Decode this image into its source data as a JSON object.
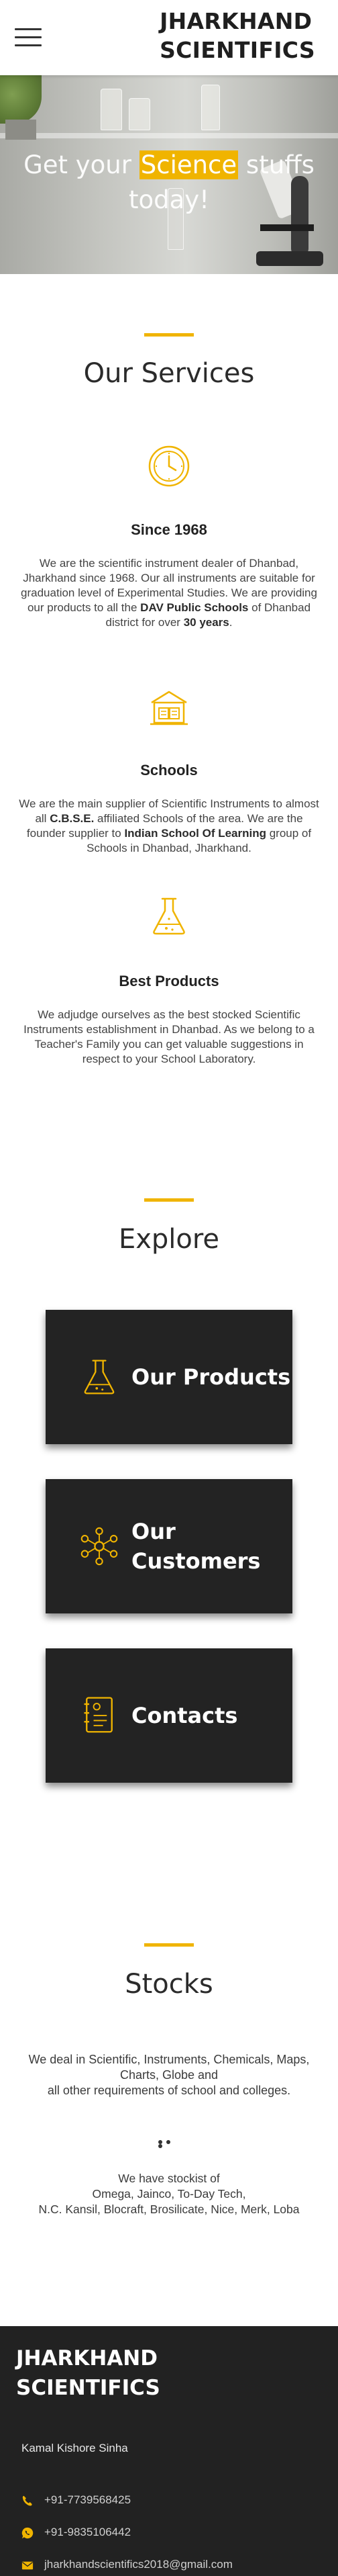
{
  "header": {
    "brand_line1": "JHARKHAND",
    "brand_line2": "SCIENTIFICS",
    "menu_icon": "hamburger-menu-icon"
  },
  "hero": {
    "title_before": "Get your ",
    "title_highlight": "Science",
    "title_after": " stuffs",
    "title_line2": "today!",
    "highlight_color": "#f0b400"
  },
  "services": {
    "heading": "Our Services",
    "items": [
      {
        "icon": "clock-icon",
        "title": "Since 1968",
        "text_1": "We are the scientific instrument dealer of Dhanbad, Jharkhand since 1968. Our all instruments are suitable for graduation level of Experimental Studies. We are providing our products to all the ",
        "bold_1": "DAV Public Schools",
        "text_2": " of Dhanbad district for over ",
        "bold_2": "30 years",
        "text_3": "."
      },
      {
        "icon": "school-book-icon",
        "title": "Schools",
        "text_1": "We are the main supplier of Scientific Instruments to almost all ",
        "bold_1": "C.B.S.E.",
        "text_2": " affiliated Schools of the area. We are the founder supplier to ",
        "bold_2": "Indian School Of Learning",
        "text_3": " group of Schools in Dhanbad, Jharkhand."
      },
      {
        "icon": "flask-icon",
        "title": "Best Products",
        "text_1": "We adjudge ourselves as the best stocked Scientific Instruments establishment in Dhanbad. As we belong to a Teacher's Family you can get valuable suggestions in respect to your School Laboratory."
      }
    ]
  },
  "explore": {
    "heading": "Explore",
    "cards": [
      {
        "icon": "flask-icon",
        "label_1": "Our Products",
        "label_2": ""
      },
      {
        "icon": "network-people-icon",
        "label_1": "Our",
        "label_2": "Customers"
      },
      {
        "icon": "contact-list-icon",
        "label_1": "Contacts",
        "label_2": ""
      }
    ]
  },
  "stocks": {
    "heading": "Stocks",
    "line_1": "We deal in Scientific, Instruments, Chemicals, Maps, Charts, Globe and",
    "line_2": "all other requirements of school and colleges.",
    "stockist_1": "We have stockist of",
    "stockist_2": "Omega, Jainco, To-Day Tech,",
    "stockist_3": "N.C. Kansil, Blocraft, Brosilicate, Nice, Merk, Loba"
  },
  "footer": {
    "brand_line1": "JHARKHAND",
    "brand_line2": "SCIENTIFICS",
    "owner": "Kamal Kishore Sinha",
    "phone": "+91-7739568425",
    "whatsapp": "+91-9835106442",
    "email": "jharkhandscientifics2018@gmail.com"
  },
  "colors": {
    "accent": "#f0b400",
    "dark_card": "#232323",
    "footer_bg": "#222222"
  }
}
